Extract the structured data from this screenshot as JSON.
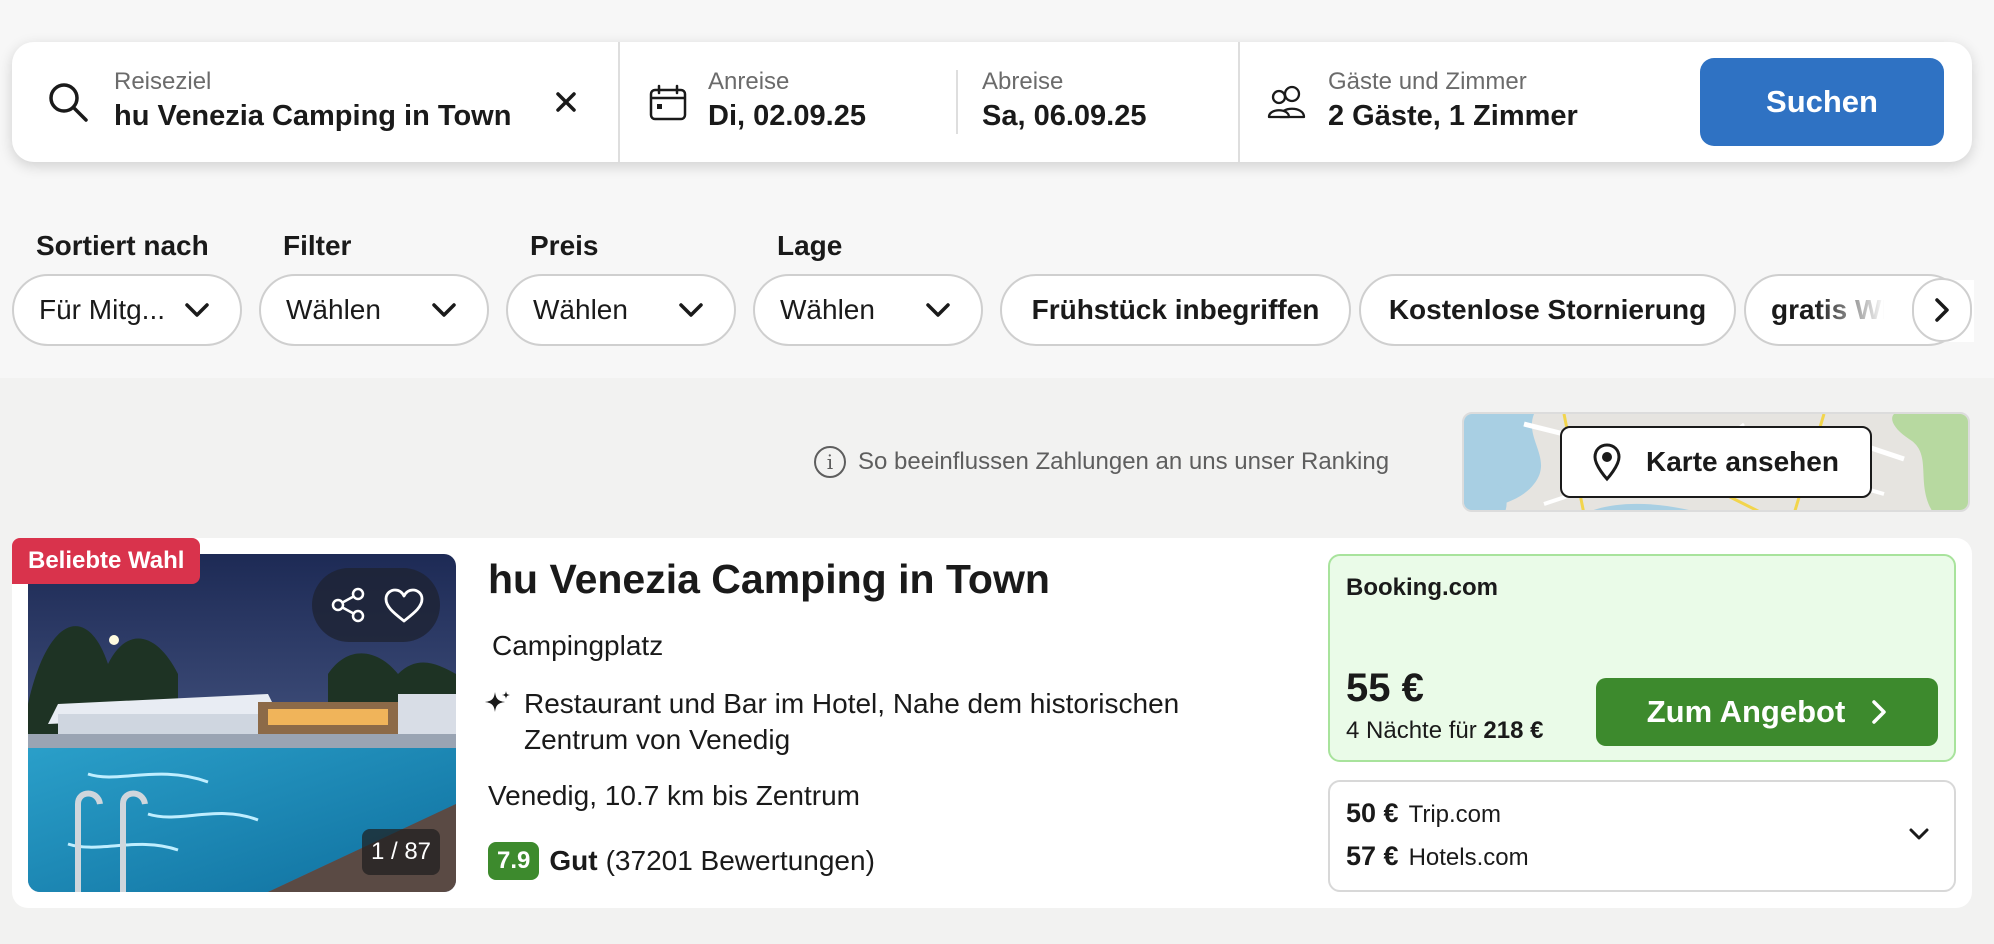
{
  "search": {
    "destination_label": "Reiseziel",
    "destination_value": "hu Venezia Camping in Town",
    "checkin_label": "Anreise",
    "checkin_value": "Di, 02.09.25",
    "checkout_label": "Abreise",
    "checkout_value": "Sa, 06.09.25",
    "guests_label": "Gäste und Zimmer",
    "guests_value": "2 Gäste, 1 Zimmer",
    "search_button": "Suchen"
  },
  "filters": {
    "sort": {
      "label": "Sortiert nach",
      "value": "Für Mitg..."
    },
    "filter": {
      "label": "Filter",
      "value": "Wählen"
    },
    "price": {
      "label": "Preis",
      "value": "Wählen"
    },
    "location": {
      "label": "Lage",
      "value": "Wählen"
    },
    "quick": [
      "Frühstück inbegriffen",
      "Kostenlose Stornierung",
      "gratis WLAN"
    ]
  },
  "ranking_info": "So beeinflussen Zahlungen an uns unser Ranking",
  "map_button": "Karte ansehen",
  "hotel": {
    "badge": "Beliebte Wahl",
    "photo_counter": "1 / 87",
    "name": "hu Venezia Camping in Town",
    "type": "Campingplatz",
    "features": "Restaurant und Bar im Hotel, Nahe dem historischen Zentrum von Venedig",
    "location": "Venedig, 10.7 km bis Zentrum",
    "rating_score": "7.9",
    "rating_word": "Gut",
    "rating_count": "(37201 Bewertungen)",
    "deal": {
      "provider": "Booking.com",
      "price": "55 €",
      "nights_text": "4 Nächte für",
      "total": "218 €",
      "button": "Zum Angebot"
    },
    "other_offers": [
      {
        "price": "50 €",
        "provider": "Trip.com"
      },
      {
        "price": "57 €",
        "provider": "Hotels.com"
      }
    ]
  }
}
